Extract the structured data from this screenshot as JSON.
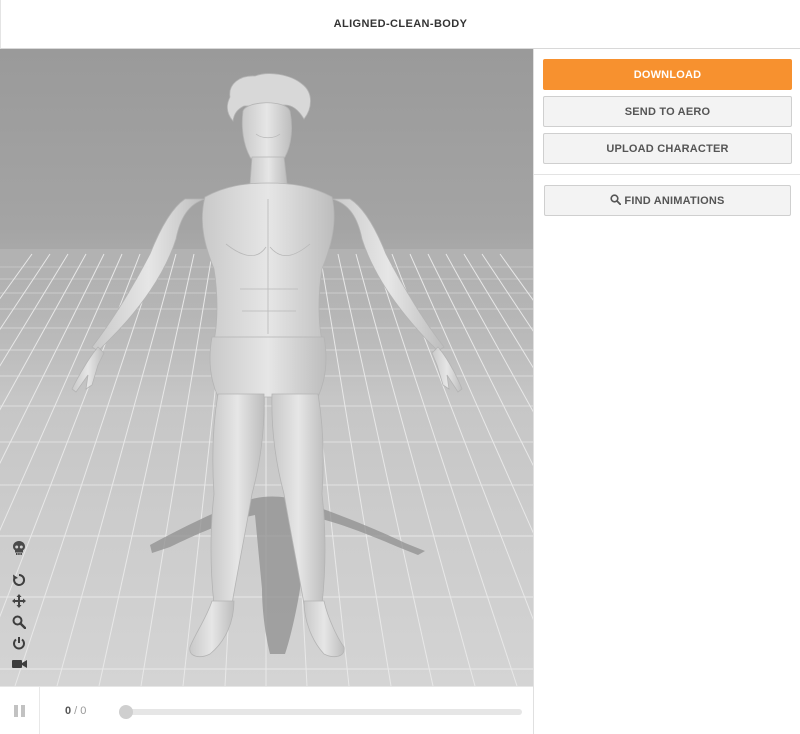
{
  "header": {
    "title": "ALIGNED-CLEAN-BODY"
  },
  "panel": {
    "download_label": "DOWNLOAD",
    "send_label": "SEND TO AERO",
    "upload_label": "UPLOAD CHARACTER",
    "find_label": "FIND ANIMATIONS",
    "accent_color": "#f7912f"
  },
  "viewport": {
    "tool_icons": [
      "skull-icon",
      "reset-icon",
      "move-icon",
      "zoom-icon",
      "power-icon",
      "camera-icon"
    ]
  },
  "playback": {
    "current_frame": "0",
    "separator": " / ",
    "total_frames": "0",
    "progress": 0
  }
}
